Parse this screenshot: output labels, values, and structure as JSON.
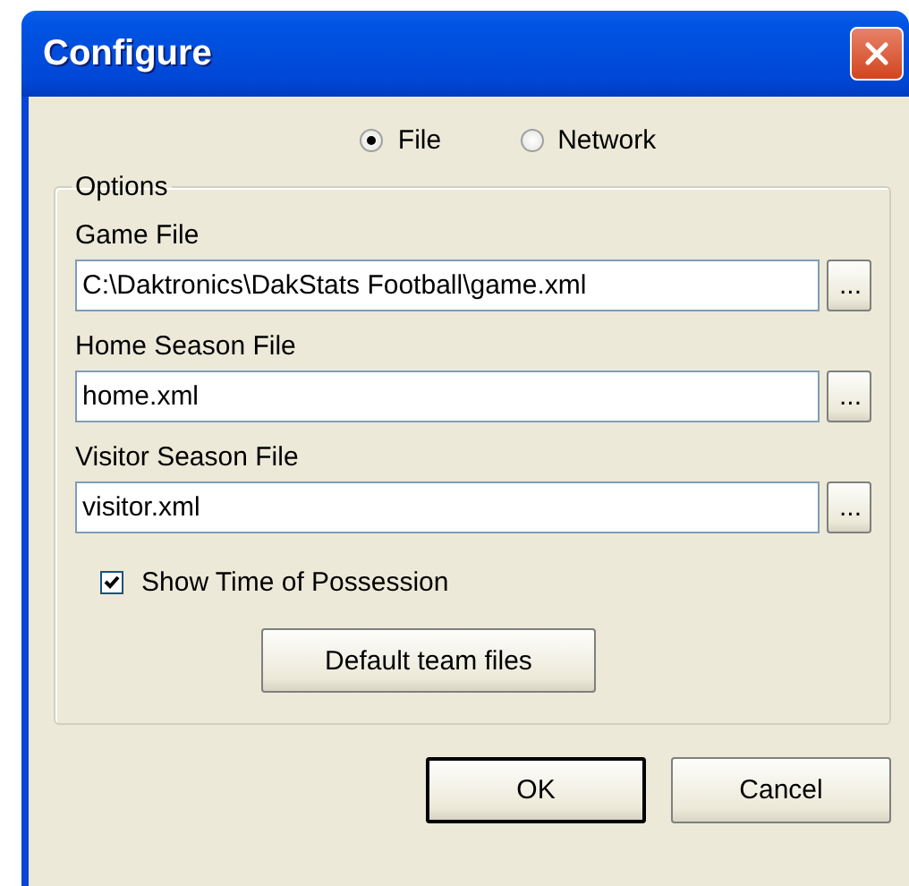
{
  "window": {
    "title": "Configure"
  },
  "source": [
    {
      "label": "File",
      "selected": true
    },
    {
      "label": "Network",
      "selected": false
    }
  ],
  "options": {
    "title": "Options",
    "files": [
      {
        "label": "Game File",
        "value": "C:\\Daktronics\\DakStats Football\\game.xml",
        "browse": "..."
      },
      {
        "label": "Home Season File",
        "value": "home.xml",
        "browse": "..."
      },
      {
        "label": "Visitor Season File",
        "value": "visitor.xml",
        "browse": "..."
      }
    ],
    "show_time_of_possession": {
      "label": "Show Time of Possession",
      "checked": true
    },
    "default_files_button": "Default team files"
  },
  "buttons": [
    {
      "label": "OK",
      "default": true
    },
    {
      "label": "Cancel",
      "default": false
    }
  ]
}
